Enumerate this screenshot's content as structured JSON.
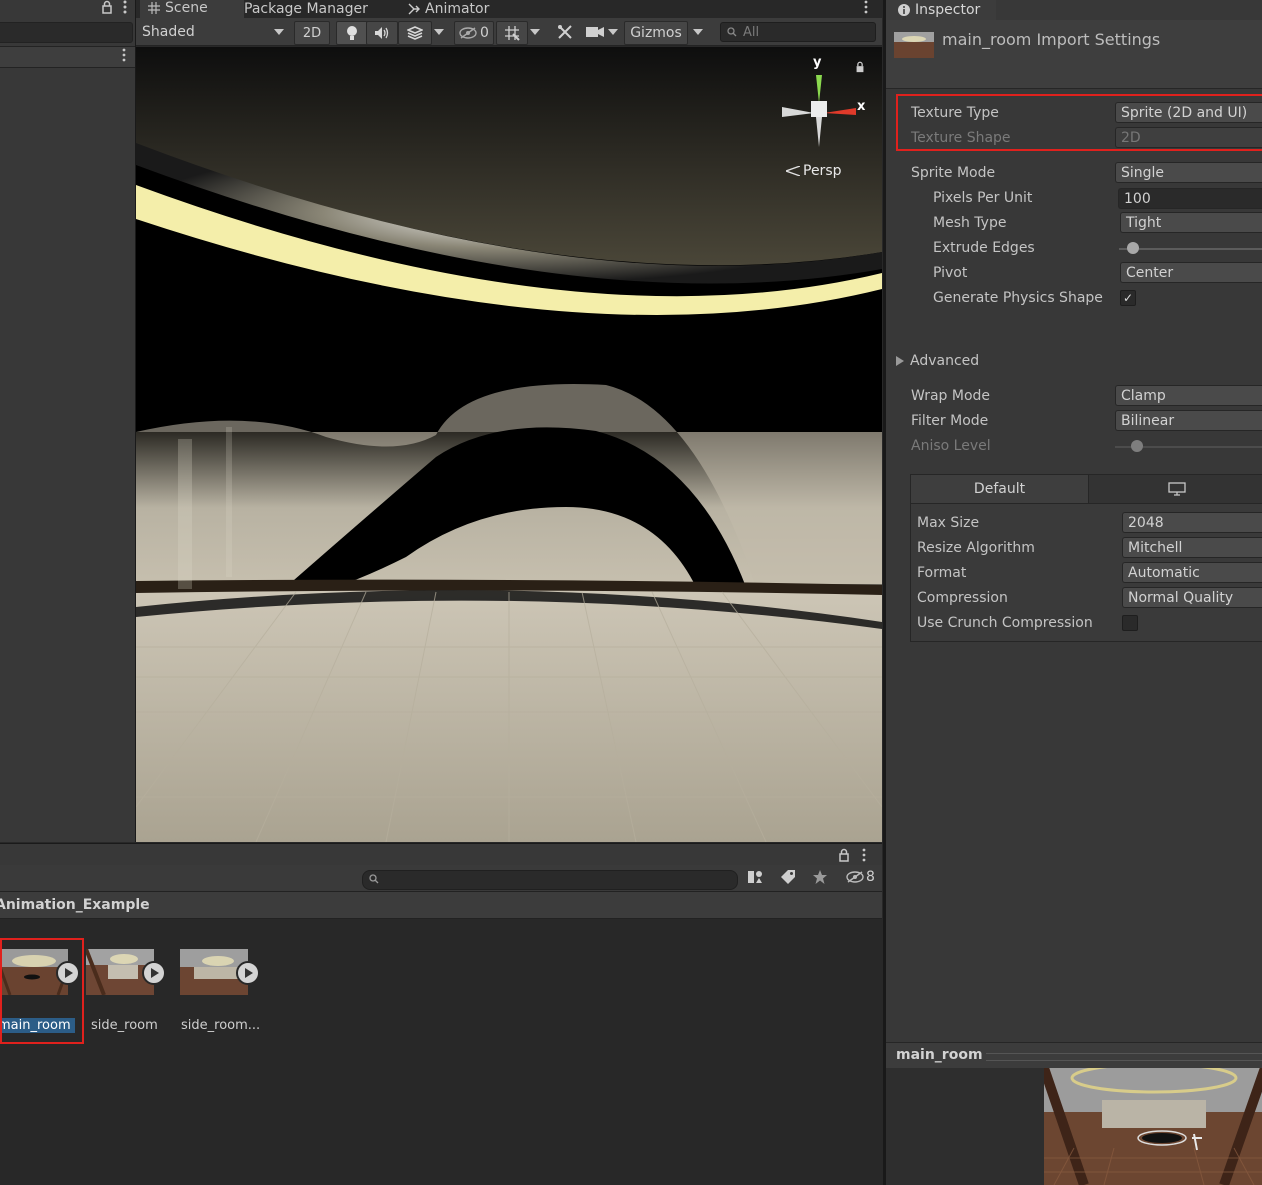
{
  "scene_tabs": {
    "scene": "Scene",
    "package_manager": "Package Manager",
    "animator": "Animator"
  },
  "toolbar": {
    "shading_mode": "Shaded",
    "mode_2d": "2D",
    "hidden_count": "0",
    "gizmos": "Gizmos",
    "search_placeholder": "All"
  },
  "viewport": {
    "projection": "Persp",
    "axis_y": "y",
    "axis_x": "x"
  },
  "project": {
    "hidden_count": "8",
    "breadcrumb": "Animation_Example",
    "assets": [
      {
        "name": "main_room",
        "selected": true
      },
      {
        "name": "side_room",
        "selected": false
      },
      {
        "name": "side_room...",
        "selected": false
      }
    ]
  },
  "inspector": {
    "tab": "Inspector",
    "title": "main_room Import Settings",
    "texture_type": {
      "label": "Texture Type",
      "value": "Sprite (2D and UI)"
    },
    "texture_shape": {
      "label": "Texture Shape",
      "value": "2D"
    },
    "sprite_mode": {
      "label": "Sprite Mode",
      "value": "Single"
    },
    "pixels_per_unit": {
      "label": "Pixels Per Unit",
      "value": "100"
    },
    "mesh_type": {
      "label": "Mesh Type",
      "value": "Tight"
    },
    "extrude_edges": {
      "label": "Extrude Edges",
      "fraction": 0.1
    },
    "pivot": {
      "label": "Pivot",
      "value": "Center"
    },
    "generate_physics_shape": {
      "label": "Generate Physics Shape",
      "checked": true,
      "mark": "✓"
    },
    "advanced": {
      "label": "Advanced"
    },
    "wrap_mode": {
      "label": "Wrap Mode",
      "value": "Clamp"
    },
    "filter_mode": {
      "label": "Filter Mode",
      "value": "Bilinear"
    },
    "aniso_level": {
      "label": "Aniso Level",
      "fraction": 0.12
    },
    "platform_tab_default": "Default",
    "max_size": {
      "label": "Max Size",
      "value": "2048"
    },
    "resize_algorithm": {
      "label": "Resize Algorithm",
      "value": "Mitchell"
    },
    "format": {
      "label": "Format",
      "value": "Automatic"
    },
    "compression": {
      "label": "Compression",
      "value": "Normal Quality"
    },
    "use_crunch": {
      "label": "Use Crunch Compression",
      "checked": false
    },
    "preview_name": "main_room"
  },
  "colors": {
    "highlight_red": "#e0211d",
    "selection_blue": "#2c5d87",
    "panel_bg": "#383838"
  },
  "icons": [
    "lock-icon",
    "kebab-menu-icon",
    "grid-icon",
    "animator-icon",
    "info-icon",
    "lightbulb-icon",
    "audio-icon",
    "effects-icon",
    "visibility-icon",
    "grid-snap-icon",
    "tools-icon",
    "camera-icon",
    "search-icon",
    "monitor-icon",
    "tag-icon",
    "star-icon",
    "filter-icon",
    "play-icon"
  ]
}
